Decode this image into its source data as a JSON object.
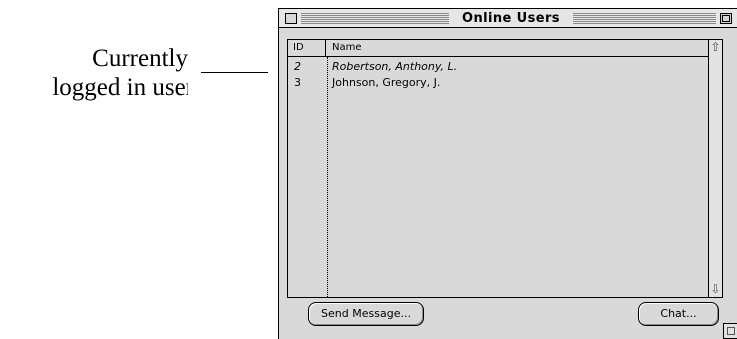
{
  "annotation": {
    "line1": "Currently",
    "line2": "logged in user"
  },
  "window": {
    "title": "Online Users"
  },
  "list": {
    "columns": [
      "ID",
      "Name"
    ],
    "rows": [
      {
        "id": "2",
        "name": "Robertson, Anthony, L.",
        "style": "italic"
      },
      {
        "id": "3",
        "name": "Johnson, Gregory, J.",
        "style": "normal"
      }
    ]
  },
  "buttons": {
    "send_message": "Send Message...",
    "chat": "Chat..."
  },
  "icons": {
    "scroll_up": "up-arrow-icon",
    "scroll_down": "down-arrow-icon",
    "close": "close-box-icon",
    "zoom": "zoom-box-icon",
    "grow": "resize-grow-icon"
  }
}
